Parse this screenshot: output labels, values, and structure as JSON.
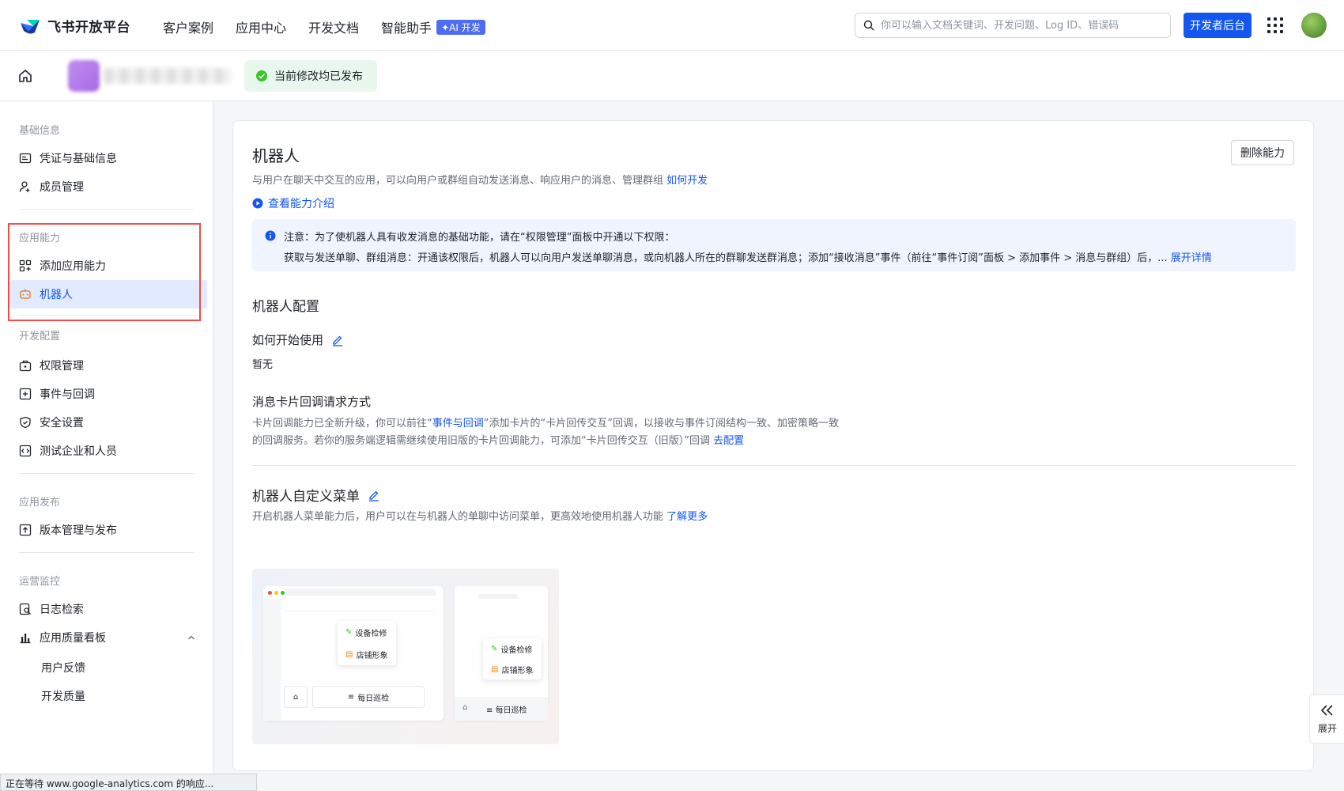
{
  "topnav": {
    "logo_text": "飞书开放平台",
    "items": [
      {
        "label": "客户案例"
      },
      {
        "label": "应用中心"
      },
      {
        "label": "开发文档"
      },
      {
        "label": "智能助手"
      }
    ],
    "ai_badge": "✦AI 开发",
    "search_placeholder": "你可以输入文档关键词、开发问题、Log ID、错误码",
    "dev_button": "开发者后台"
  },
  "subbar": {
    "publish_status": "当前修改均已发布"
  },
  "sidebar": {
    "groups": [
      {
        "title": "基础信息",
        "items": [
          "凭证与基础信息",
          "成员管理"
        ]
      },
      {
        "title": "应用能力",
        "items": [
          "添加应用能力",
          "机器人"
        ]
      },
      {
        "title": "开发配置",
        "items": [
          "权限管理",
          "事件与回调",
          "安全设置",
          "测试企业和人员"
        ]
      },
      {
        "title": "应用发布",
        "items": [
          "版本管理与发布"
        ]
      },
      {
        "title": "运营监控",
        "items": [
          "日志检索",
          "应用质量看板"
        ],
        "subitems": [
          "用户反馈",
          "开发质量"
        ]
      }
    ]
  },
  "main": {
    "title": "机器人",
    "desc": "与用户在聊天中交互的应用，可以向用户或群组自动发送消息、响应用户的消息、管理群组",
    "desc_link": "如何开发",
    "delete_button": "删除能力",
    "view_intro": "查看能力介绍",
    "notice_line1": "注意：为了使机器人具有收发消息的基础功能，请在“权限管理”面板中开通以下权限：",
    "notice_line2": "获取与发送单聊、群组消息：开通该权限后，机器人可以向用户发送单聊消息，或向机器人所在的群聊发送群消息；添加“接收消息”事件（前往“事件订阅”面板 > 添加事件 > 消息与群组）后，...",
    "notice_link": "展开详情",
    "config_title": "机器人配置",
    "how_to_use_title": "如何开始使用",
    "how_to_use_value": "暂无",
    "card_callback_title": "消息卡片回调请求方式",
    "card_callback_text1a": "卡片回调能力已全新升级，你可以前往“",
    "card_callback_link1": "事件与回调",
    "card_callback_text1b": "”添加卡片的“卡片回传交互”回调，以接收与事件订阅结构一致、加密策略一致",
    "card_callback_text2": "的回调服务。若你的服务端逻辑需继续使用旧版的卡片回调能力，可添加“卡片回传交互（旧版）”回调",
    "card_callback_link2": "去配置",
    "menu_title": "机器人自定义菜单",
    "menu_desc": "开启机器人菜单能力后，用户可以在与机器人的单聊中访问菜单，更高效地使用机器人功能",
    "menu_link": "了解更多",
    "illustration": {
      "item1": "设备检修",
      "item2": "店铺形象",
      "item3": "每日巡检"
    }
  },
  "expand_tab": "展开",
  "status_bar": "正在等待 www.google-analytics.com 的响应..."
}
